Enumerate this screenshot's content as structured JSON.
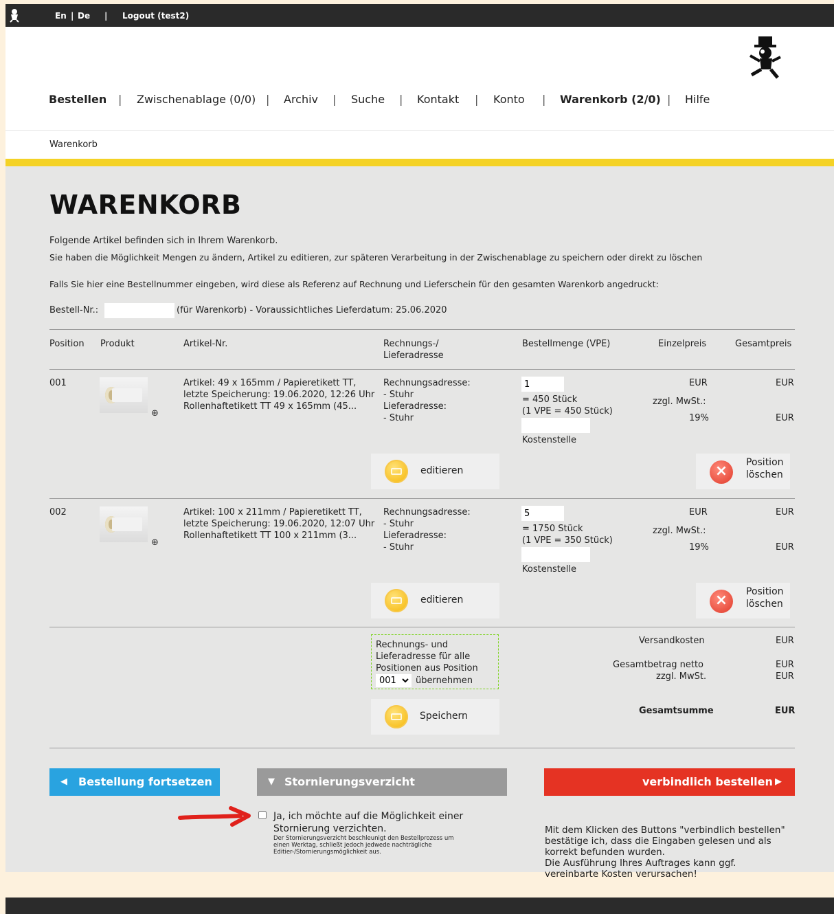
{
  "topbar": {
    "lang_en": "En",
    "lang_sep": "|",
    "lang_de": "De",
    "sep2": "|",
    "logout": "Logout (test2)"
  },
  "nav": {
    "items": [
      {
        "label": "Bestellen"
      },
      {
        "label": "Zwischenablage (0/0)"
      },
      {
        "label": "Archiv"
      },
      {
        "label": "Suche"
      },
      {
        "label": "Kontakt"
      },
      {
        "label": "Konto"
      },
      {
        "label": "Warenkorb (2/0)"
      },
      {
        "label": "Hilfe"
      }
    ],
    "separator": "|"
  },
  "breadcrumb": "Warenkorb",
  "page": {
    "title": "WARENKORB",
    "intro1": "Folgende Artikel befinden sich in Ihrem Warenkorb.",
    "intro2": "Sie haben die Möglichkeit Mengen zu ändern, Artikel zu editieren, zur späteren Verarbeitung in der Zwischenablage zu speichern oder direkt zu löschen",
    "intro3": "Falls Sie hier eine Bestellnummer eingeben, wird diese als Referenz auf Rechnung und Lieferschein für den gesamten Warenkorb angedruckt:",
    "order_no_label": "Bestell-Nr.:",
    "order_no_value": "",
    "order_no_suffix": "(für Warenkorb) - Voraussichtliches Lieferdatum: 25.06.2020"
  },
  "table": {
    "headers": {
      "position": "Position",
      "product": "Produkt",
      "article_no": "Artikel-Nr.",
      "address_1": "Rechnungs-/",
      "address_2": "Lieferadresse",
      "quantity": "Bestellmenge (VPE)",
      "unit_price": "Einzelpreis",
      "total_price": "Gesamtpreis"
    },
    "rows": [
      {
        "position": "001",
        "article_line1": "Artikel: 49 x 165mm / Papieretikett TT,",
        "article_line2": "letzte Speicherung: 19.06.2020, 12:26 Uhr",
        "article_line3": "Rollenhaftetikett TT 49 x 165mm (45...",
        "billing_label": "Rechnungsadresse:",
        "billing_value": "- Stuhr",
        "delivery_label": "Lieferadresse:",
        "delivery_value": "- Stuhr",
        "quantity": "1",
        "pieces": "= 450 Stück",
        "vpe": "(1 VPE = 450 Stück)",
        "cost_center_value": "",
        "cost_center_label": "Kostenstelle",
        "unit_currency": "EUR",
        "vat_label": "zzgl. MwSt.:",
        "vat_rate": "19%",
        "total_currency": "EUR",
        "vat_currency": "EUR",
        "edit_label": "editieren",
        "delete_label_1": "Position",
        "delete_label_2": "löschen"
      },
      {
        "position": "002",
        "article_line1": "Artikel: 100 x 211mm / Papieretikett TT,",
        "article_line2": "letzte Speicherung: 19.06.2020, 12:07 Uhr",
        "article_line3": "Rollenhaftetikett TT 100 x 211mm (3...",
        "billing_label": "Rechnungsadresse:",
        "billing_value": "- Stuhr",
        "delivery_label": "Lieferadresse:",
        "delivery_value": "- Stuhr",
        "quantity": "5",
        "pieces": "= 1750 Stück",
        "vpe": "(1 VPE = 350 Stück)",
        "cost_center_value": "",
        "cost_center_label": "Kostenstelle",
        "unit_currency": "EUR",
        "vat_label": "zzgl. MwSt.:",
        "vat_rate": "19%",
        "total_currency": "EUR",
        "vat_currency": "EUR",
        "edit_label": "editieren",
        "delete_label_1": "Position",
        "delete_label_2": "löschen"
      }
    ]
  },
  "summary": {
    "copy_address_1": "Rechnungs- und",
    "copy_address_2": "Lieferadresse für alle",
    "copy_address_3": "Positionen aus Position",
    "copy_address_select": "001",
    "copy_address_4": "übernehmen",
    "save_label": "Speichern",
    "shipping_label": "Versandkosten",
    "shipping_currency": "EUR",
    "net_label": "Gesamtbetrag netto",
    "net_currency": "EUR",
    "vat_label": "zzgl. MwSt.",
    "vat_currency": "EUR",
    "grand_label": "Gesamtsumme",
    "grand_currency": "EUR"
  },
  "actions": {
    "continue_label": "Bestellung fortsetzen",
    "waiver_label": "Stornierungsverzicht",
    "order_label": "verbindlich bestellen",
    "waiver_check_1": "Ja, ich möchte auf die Möglichkeit einer",
    "waiver_check_2": "Stornierung verzichten.",
    "waiver_note_1": "Der Stornierungsverzicht beschleunigt den Bestellprozess um",
    "waiver_note_2": "einen Werktag, schließt jedoch jedwede nachträgliche",
    "waiver_note_3": "Editier-/Stornierungsmöglichkeit aus.",
    "order_note_1": "Mit dem Klicken des Buttons \"verbindlich bestellen\"",
    "order_note_2": "bestätige ich, dass die Eingaben gelesen und als",
    "order_note_3": "korrekt befunden wurden.",
    "order_note_4": "Die Ausführung Ihres Auftrages kann ggf.",
    "order_note_5": "vereinbarte Kosten verursachen!"
  },
  "colors": {
    "accent_yellow": "#f4d225",
    "continue_blue": "#29a3e0",
    "waiver_gray": "#9a9a9a",
    "order_red": "#e53323",
    "annotation_arrow": "#e0211b"
  }
}
